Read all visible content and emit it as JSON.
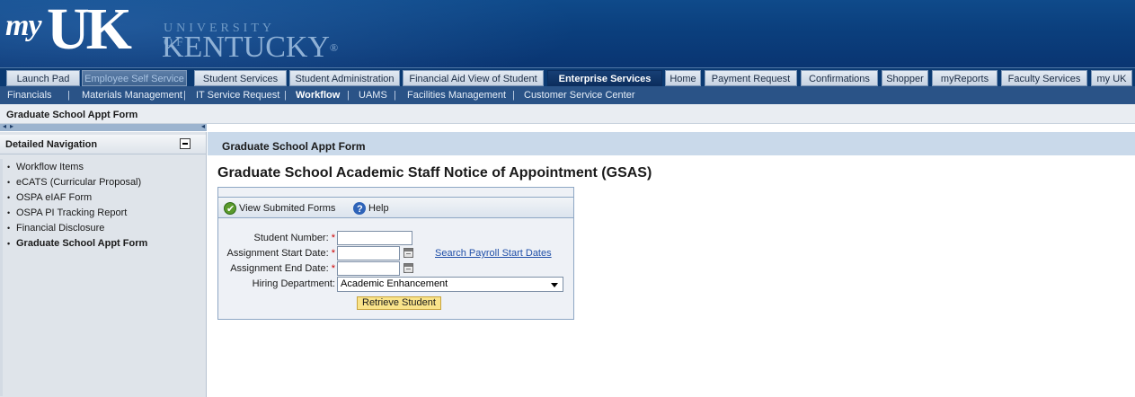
{
  "branding": {
    "my": "my",
    "uk": "UK",
    "university_of": "UNIVERSITY OF",
    "kentucky": "KENTUCKY",
    "registered": "®"
  },
  "top_nav": {
    "tabs": [
      {
        "label": "Launch Pad"
      },
      {
        "label": "Employee Self Service"
      },
      {
        "label": "Student Services"
      },
      {
        "label": "Student Administration"
      },
      {
        "label": "Financial Aid View of Student"
      },
      {
        "label": "Enterprise Services",
        "active": true
      },
      {
        "label": "Home"
      },
      {
        "label": "Payment Request"
      },
      {
        "label": "Confirmations"
      },
      {
        "label": "Shopper"
      },
      {
        "label": "myReports"
      },
      {
        "label": "Faculty Services"
      },
      {
        "label": "my UK"
      }
    ]
  },
  "sub_nav": {
    "items": [
      {
        "label": "Financials"
      },
      {
        "label": "Materials Management"
      },
      {
        "label": "IT Service Request"
      },
      {
        "label": "Workflow",
        "active": true
      },
      {
        "label": "UAMS"
      },
      {
        "label": "Facilities Management"
      },
      {
        "label": "Customer Service Center"
      }
    ],
    "separator": "|"
  },
  "page_title": "Graduate School Appt Form",
  "pager": {
    "prev_icon": "◂",
    "next_icon": "▸",
    "left_icon": "◂"
  },
  "left_nav": {
    "title": "Detailed Navigation",
    "items": [
      {
        "label": "Workflow Items"
      },
      {
        "label": "eCATS (Curricular Proposal)"
      },
      {
        "label": "OSPA eIAF Form"
      },
      {
        "label": "OSPA PI Tracking Report"
      },
      {
        "label": "Financial Disclosure"
      },
      {
        "label": "Graduate School Appt Form",
        "selected": true
      }
    ]
  },
  "main": {
    "header": "Graduate School Appt Form",
    "heading": "Graduate School Academic Staff Notice of Appointment (GSAS)",
    "toolbar": {
      "view_submitted": "View Submited Forms",
      "help": "Help"
    },
    "form": {
      "student_number_label": "Student Number:",
      "start_date_label": "Assignment Start Date:",
      "end_date_label": "Assignment End Date:",
      "hiring_department_label": "Hiring Department:",
      "required_marker": "*",
      "student_number_value": "",
      "start_date_value": "",
      "end_date_value": "",
      "search_payroll_link": "Search Payroll Start Dates",
      "hiring_department_value": "Academic Enhancement",
      "retrieve_button": "Retrieve Student"
    }
  },
  "colors": {
    "banner": "#0b3f7d",
    "active_tab": "#0c2e5e",
    "subnav": "#2a5387",
    "link": "#1f4fa8",
    "button": "#f9e38a",
    "required": "#cc0000"
  }
}
